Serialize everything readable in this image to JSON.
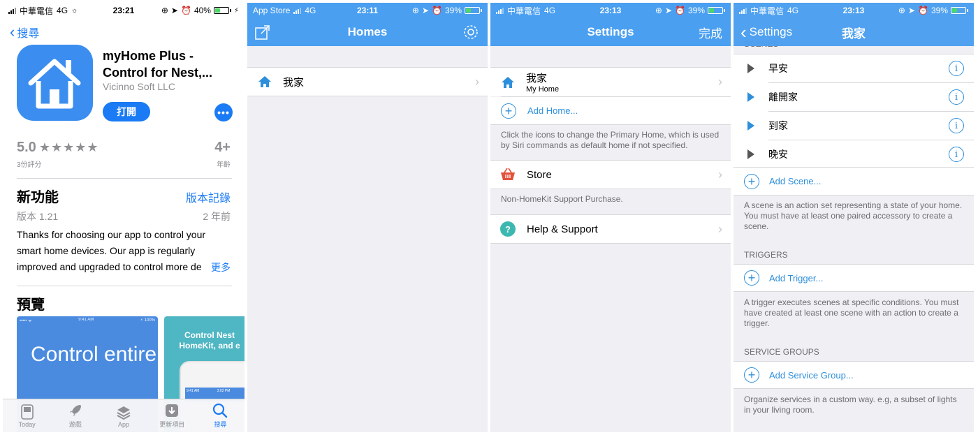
{
  "colors": {
    "ios_blue": "#1a7bf5",
    "bar_blue": "#4a9ff0",
    "link_blue": "#2d8fdc",
    "store_red": "#e2513b",
    "help_teal": "#3cb8b0"
  },
  "screen1": {
    "status": {
      "carrier": "中華電信",
      "network": "4G",
      "time": "23:21",
      "battery": "40%"
    },
    "back_label": "搜尋",
    "app": {
      "title": "myHome Plus - Control for Nest,...",
      "developer": "Vicinno Soft LLC",
      "open_label": "打開",
      "more_label": "•••"
    },
    "rating": {
      "score": "5.0",
      "stars": "★★★★★",
      "count": "3份評分",
      "age": "4+",
      "age_label": "年齡"
    },
    "whats_new": {
      "title": "新功能",
      "history_link": "版本記錄",
      "version": "版本 1.21",
      "ago": "2 年前",
      "notes": "Thanks for choosing our app to control your smart home devices. Our app is regularly improved and upgraded to control more de",
      "more": "更多"
    },
    "preview": {
      "title": "預覽",
      "shot1_status_left": "•••••  ᯤ",
      "shot1_time": "9:41 AM",
      "shot1_status_right": "⚡ 100%",
      "shot1_text": "Control entire",
      "shot2_text": "Control Nest HomeKit, and e",
      "shot2_time": "9:41 AM",
      "shot2_time2": "3:02 PM"
    },
    "tabs": [
      {
        "label": "Today",
        "icon": "today-icon"
      },
      {
        "label": "遊戲",
        "icon": "rocket-icon"
      },
      {
        "label": "App",
        "icon": "layers-icon"
      },
      {
        "label": "更新項目",
        "icon": "download-icon"
      },
      {
        "label": "搜尋",
        "icon": "search-icon",
        "active": true
      }
    ]
  },
  "screen2": {
    "status": {
      "back_app": "App Store",
      "network": "4G",
      "time": "23:11",
      "battery": "39%"
    },
    "title": "Homes",
    "rows": [
      {
        "label": "我家"
      }
    ]
  },
  "screen3": {
    "status": {
      "carrier": "中華電信",
      "network": "4G",
      "time": "23:13",
      "battery": "39%"
    },
    "title": "Settings",
    "done_label": "完成",
    "home": {
      "name": "我家",
      "subtitle": "My Home"
    },
    "add_home": "Add Home...",
    "home_footer": "Click the icons to change the Primary Home, which is used by Siri commands as default home if not specified.",
    "store": {
      "label": "Store",
      "footer": "Non-HomeKit Support Purchase."
    },
    "help": {
      "label": "Help & Support"
    }
  },
  "screen4": {
    "status": {
      "carrier": "中華電信",
      "network": "4G",
      "time": "23:13",
      "battery": "39%"
    },
    "back_label": "Settings",
    "title": "我家",
    "scenes_header": "SCENES",
    "scenes": [
      {
        "name": "早安",
        "active": false
      },
      {
        "name": "離開家",
        "active": true
      },
      {
        "name": "到家",
        "active": true
      },
      {
        "name": "晚安",
        "active": false
      }
    ],
    "add_scene": "Add Scene...",
    "scene_footer": "A scene is an action set representing a state of your home. You must have at least one paired accessory to create a scene.",
    "triggers_header": "TRIGGERS",
    "add_trigger": "Add Trigger...",
    "trigger_footer": "A trigger executes scenes at specific conditions. You must have created at least one scene with an action to create a trigger.",
    "groups_header": "SERVICE GROUPS",
    "add_group": "Add Service Group...",
    "group_footer": "Organize services in a custom way. e.g, a subset of lights in your living room."
  }
}
